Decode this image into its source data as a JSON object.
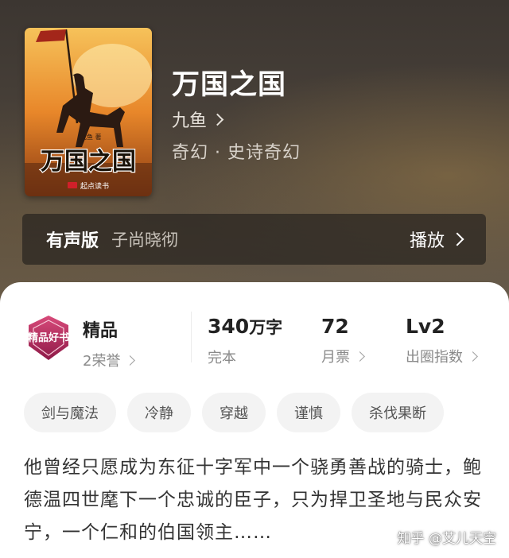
{
  "book": {
    "title": "万国之国",
    "author": "九鱼",
    "genre": "奇幻 · 史诗奇幻",
    "cover": {
      "title": "万国之国",
      "author_tag": "九鱼 著",
      "publisher": "起点读书"
    }
  },
  "audio": {
    "label": "有声版",
    "narrator": "子尚晓彻",
    "play_label": "播放"
  },
  "stats": {
    "quality": {
      "title": "精品",
      "honor": "2荣誉",
      "badge_text": "精品好书"
    },
    "words": {
      "value": "340",
      "unit": "万字",
      "status": "完本"
    },
    "tickets": {
      "value": "72",
      "label": "月票"
    },
    "level": {
      "value": "Lv2",
      "label": "出圈指数"
    }
  },
  "tags": [
    "剑与魔法",
    "冷静",
    "穿越",
    "谨慎",
    "杀伐果断"
  ],
  "description": "他曾经只愿成为东征十字军中一个骁勇善战的骑士，鲍德温四世麾下一个忠诚的臣子，只为捍卫圣地与民众安宁，一个仁和的伯国领主……",
  "watermark": "知乎 @艾儿天空",
  "colors": {
    "accent_badge": "#b0245a",
    "panel_bg": "#ffffff",
    "tag_bg": "#f3f3f3"
  }
}
